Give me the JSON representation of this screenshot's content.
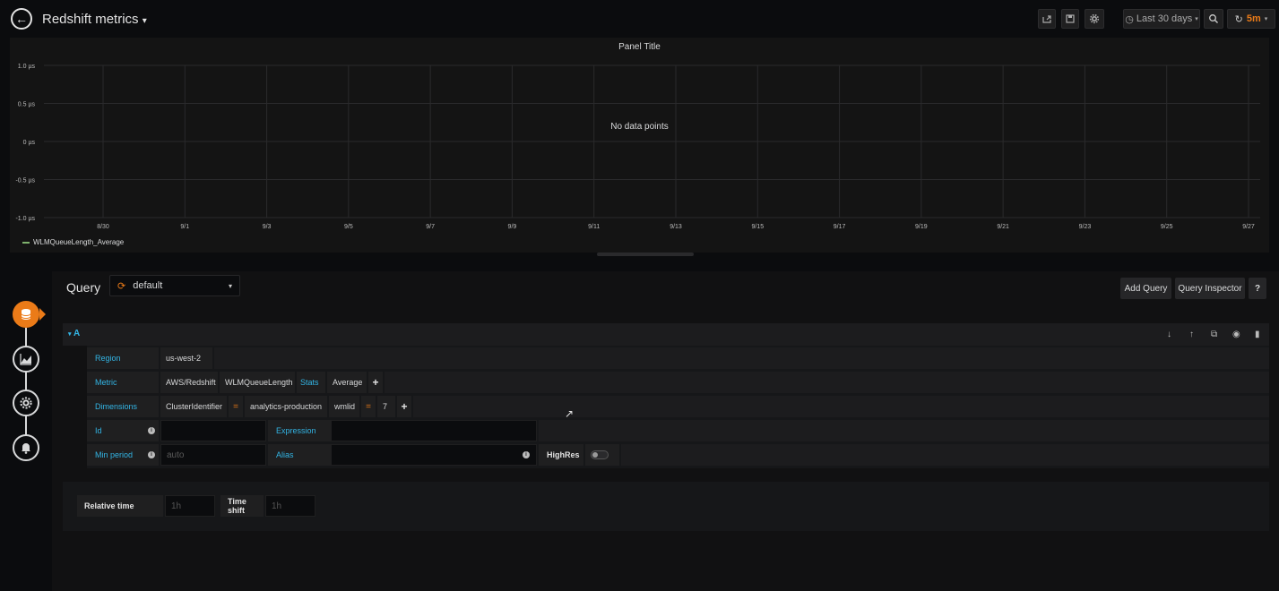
{
  "header": {
    "title": "Redshift metrics",
    "time_range": "Last 30 days",
    "refresh_interval": "5m"
  },
  "panel": {
    "title": "Panel Title",
    "no_data": "No data points",
    "legend": "WLMQueueLength_Average"
  },
  "chart_data": {
    "type": "line",
    "title": "Panel Title",
    "y_ticks": [
      "1.0 µs",
      "0.5 µs",
      "0 µs",
      "-0.5 µs",
      "-1.0 µs"
    ],
    "x_ticks": [
      "8/30",
      "9/1",
      "9/3",
      "9/5",
      "9/7",
      "9/9",
      "9/11",
      "9/13",
      "9/15",
      "9/17",
      "9/19",
      "9/21",
      "9/23",
      "9/25",
      "9/27"
    ],
    "ylim": [
      -1.0,
      1.0
    ],
    "series": [
      {
        "name": "WLMQueueLength_Average",
        "values": []
      }
    ],
    "grid": true,
    "legend_position": "bottom-left"
  },
  "query_editor": {
    "label": "Query",
    "datasource": "default",
    "add_query": "Add Query",
    "query_inspector": "Query Inspector",
    "help": "?"
  },
  "query_a": {
    "ref_id": "A",
    "region_label": "Region",
    "region_value": "us-west-2",
    "metric_label": "Metric",
    "namespace": "AWS/Redshift",
    "metric_name": "WLMQueueLength",
    "stats_label": "Stats",
    "stat_value": "Average",
    "dimensions_label": "Dimensions",
    "dim1_key": "ClusterIdentifier",
    "dim1_op": "=",
    "dim1_value": "analytics-production",
    "dim2_key": "wmlid",
    "dim2_op": "=",
    "dim2_value": "7",
    "id_label": "Id",
    "expression_label": "Expression",
    "min_period_label": "Min period",
    "min_period_placeholder": "auto",
    "alias_label": "Alias",
    "highres_label": "HighRes"
  },
  "time_options": {
    "relative_time_label": "Relative time",
    "relative_time_placeholder": "1h",
    "time_shift_label": "Time shift",
    "time_shift_placeholder": "1h"
  },
  "icons": [
    "back-arrow-icon",
    "share-icon",
    "save-icon",
    "gear-icon",
    "clock-icon",
    "zoom-out-icon",
    "refresh-icon",
    "database-icon",
    "visualization-icon",
    "general-settings-icon",
    "alert-bell-icon",
    "move-down-icon",
    "move-up-icon",
    "duplicate-icon",
    "eye-icon",
    "trash-icon",
    "info-icon"
  ],
  "colors": {
    "accent": "#eb7b18",
    "link": "#33b5e5",
    "series": "#7eb26d"
  }
}
